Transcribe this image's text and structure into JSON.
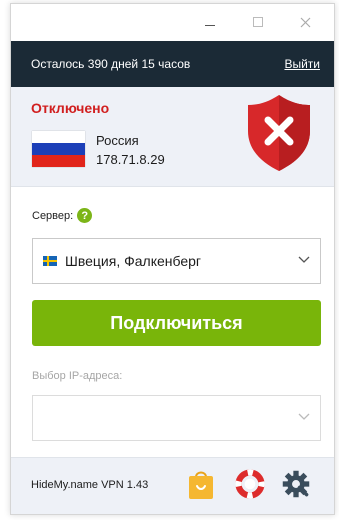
{
  "window": {
    "controls": [
      "minimize",
      "maximize",
      "close"
    ]
  },
  "topbar": {
    "remaining": "Осталось 390 дней 15 часов",
    "logout": "Выйти"
  },
  "status": {
    "state": "Отключено",
    "country": "Россия",
    "ip": "178.71.8.29",
    "flag_icon": "russia-flag-icon",
    "indicator_icon": "red-shield-x-icon",
    "state_color": "#d11f1f"
  },
  "server": {
    "label": "Сервер:",
    "help_glyph": "?",
    "selected": "Швеция, Фалкенберг",
    "flag_icon": "sweden-flag-icon"
  },
  "connect_button": {
    "label": "Подключиться",
    "color": "#79b50a"
  },
  "ip_select": {
    "label": "Выбор IP-адреса:",
    "value": ""
  },
  "footer": {
    "version": "HideMy.name VPN 1.43",
    "icons": [
      "shopping-bag-icon",
      "lifebuoy-icon",
      "gear-icon"
    ]
  }
}
